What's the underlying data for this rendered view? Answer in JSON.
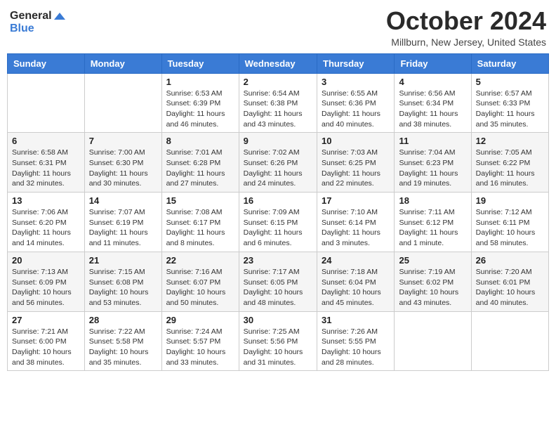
{
  "header": {
    "logo_line1": "General",
    "logo_line2": "Blue",
    "month_title": "October 2024",
    "location": "Millburn, New Jersey, United States"
  },
  "weekdays": [
    "Sunday",
    "Monday",
    "Tuesday",
    "Wednesday",
    "Thursday",
    "Friday",
    "Saturday"
  ],
  "weeks": [
    [
      {
        "day": "",
        "sunrise": "",
        "sunset": "",
        "daylight": ""
      },
      {
        "day": "",
        "sunrise": "",
        "sunset": "",
        "daylight": ""
      },
      {
        "day": "1",
        "sunrise": "Sunrise: 6:53 AM",
        "sunset": "Sunset: 6:39 PM",
        "daylight": "Daylight: 11 hours and 46 minutes."
      },
      {
        "day": "2",
        "sunrise": "Sunrise: 6:54 AM",
        "sunset": "Sunset: 6:38 PM",
        "daylight": "Daylight: 11 hours and 43 minutes."
      },
      {
        "day": "3",
        "sunrise": "Sunrise: 6:55 AM",
        "sunset": "Sunset: 6:36 PM",
        "daylight": "Daylight: 11 hours and 40 minutes."
      },
      {
        "day": "4",
        "sunrise": "Sunrise: 6:56 AM",
        "sunset": "Sunset: 6:34 PM",
        "daylight": "Daylight: 11 hours and 38 minutes."
      },
      {
        "day": "5",
        "sunrise": "Sunrise: 6:57 AM",
        "sunset": "Sunset: 6:33 PM",
        "daylight": "Daylight: 11 hours and 35 minutes."
      }
    ],
    [
      {
        "day": "6",
        "sunrise": "Sunrise: 6:58 AM",
        "sunset": "Sunset: 6:31 PM",
        "daylight": "Daylight: 11 hours and 32 minutes."
      },
      {
        "day": "7",
        "sunrise": "Sunrise: 7:00 AM",
        "sunset": "Sunset: 6:30 PM",
        "daylight": "Daylight: 11 hours and 30 minutes."
      },
      {
        "day": "8",
        "sunrise": "Sunrise: 7:01 AM",
        "sunset": "Sunset: 6:28 PM",
        "daylight": "Daylight: 11 hours and 27 minutes."
      },
      {
        "day": "9",
        "sunrise": "Sunrise: 7:02 AM",
        "sunset": "Sunset: 6:26 PM",
        "daylight": "Daylight: 11 hours and 24 minutes."
      },
      {
        "day": "10",
        "sunrise": "Sunrise: 7:03 AM",
        "sunset": "Sunset: 6:25 PM",
        "daylight": "Daylight: 11 hours and 22 minutes."
      },
      {
        "day": "11",
        "sunrise": "Sunrise: 7:04 AM",
        "sunset": "Sunset: 6:23 PM",
        "daylight": "Daylight: 11 hours and 19 minutes."
      },
      {
        "day": "12",
        "sunrise": "Sunrise: 7:05 AM",
        "sunset": "Sunset: 6:22 PM",
        "daylight": "Daylight: 11 hours and 16 minutes."
      }
    ],
    [
      {
        "day": "13",
        "sunrise": "Sunrise: 7:06 AM",
        "sunset": "Sunset: 6:20 PM",
        "daylight": "Daylight: 11 hours and 14 minutes."
      },
      {
        "day": "14",
        "sunrise": "Sunrise: 7:07 AM",
        "sunset": "Sunset: 6:19 PM",
        "daylight": "Daylight: 11 hours and 11 minutes."
      },
      {
        "day": "15",
        "sunrise": "Sunrise: 7:08 AM",
        "sunset": "Sunset: 6:17 PM",
        "daylight": "Daylight: 11 hours and 8 minutes."
      },
      {
        "day": "16",
        "sunrise": "Sunrise: 7:09 AM",
        "sunset": "Sunset: 6:15 PM",
        "daylight": "Daylight: 11 hours and 6 minutes."
      },
      {
        "day": "17",
        "sunrise": "Sunrise: 7:10 AM",
        "sunset": "Sunset: 6:14 PM",
        "daylight": "Daylight: 11 hours and 3 minutes."
      },
      {
        "day": "18",
        "sunrise": "Sunrise: 7:11 AM",
        "sunset": "Sunset: 6:12 PM",
        "daylight": "Daylight: 11 hours and 1 minute."
      },
      {
        "day": "19",
        "sunrise": "Sunrise: 7:12 AM",
        "sunset": "Sunset: 6:11 PM",
        "daylight": "Daylight: 10 hours and 58 minutes."
      }
    ],
    [
      {
        "day": "20",
        "sunrise": "Sunrise: 7:13 AM",
        "sunset": "Sunset: 6:09 PM",
        "daylight": "Daylight: 10 hours and 56 minutes."
      },
      {
        "day": "21",
        "sunrise": "Sunrise: 7:15 AM",
        "sunset": "Sunset: 6:08 PM",
        "daylight": "Daylight: 10 hours and 53 minutes."
      },
      {
        "day": "22",
        "sunrise": "Sunrise: 7:16 AM",
        "sunset": "Sunset: 6:07 PM",
        "daylight": "Daylight: 10 hours and 50 minutes."
      },
      {
        "day": "23",
        "sunrise": "Sunrise: 7:17 AM",
        "sunset": "Sunset: 6:05 PM",
        "daylight": "Daylight: 10 hours and 48 minutes."
      },
      {
        "day": "24",
        "sunrise": "Sunrise: 7:18 AM",
        "sunset": "Sunset: 6:04 PM",
        "daylight": "Daylight: 10 hours and 45 minutes."
      },
      {
        "day": "25",
        "sunrise": "Sunrise: 7:19 AM",
        "sunset": "Sunset: 6:02 PM",
        "daylight": "Daylight: 10 hours and 43 minutes."
      },
      {
        "day": "26",
        "sunrise": "Sunrise: 7:20 AM",
        "sunset": "Sunset: 6:01 PM",
        "daylight": "Daylight: 10 hours and 40 minutes."
      }
    ],
    [
      {
        "day": "27",
        "sunrise": "Sunrise: 7:21 AM",
        "sunset": "Sunset: 6:00 PM",
        "daylight": "Daylight: 10 hours and 38 minutes."
      },
      {
        "day": "28",
        "sunrise": "Sunrise: 7:22 AM",
        "sunset": "Sunset: 5:58 PM",
        "daylight": "Daylight: 10 hours and 35 minutes."
      },
      {
        "day": "29",
        "sunrise": "Sunrise: 7:24 AM",
        "sunset": "Sunset: 5:57 PM",
        "daylight": "Daylight: 10 hours and 33 minutes."
      },
      {
        "day": "30",
        "sunrise": "Sunrise: 7:25 AM",
        "sunset": "Sunset: 5:56 PM",
        "daylight": "Daylight: 10 hours and 31 minutes."
      },
      {
        "day": "31",
        "sunrise": "Sunrise: 7:26 AM",
        "sunset": "Sunset: 5:55 PM",
        "daylight": "Daylight: 10 hours and 28 minutes."
      },
      {
        "day": "",
        "sunrise": "",
        "sunset": "",
        "daylight": ""
      },
      {
        "day": "",
        "sunrise": "",
        "sunset": "",
        "daylight": ""
      }
    ]
  ]
}
